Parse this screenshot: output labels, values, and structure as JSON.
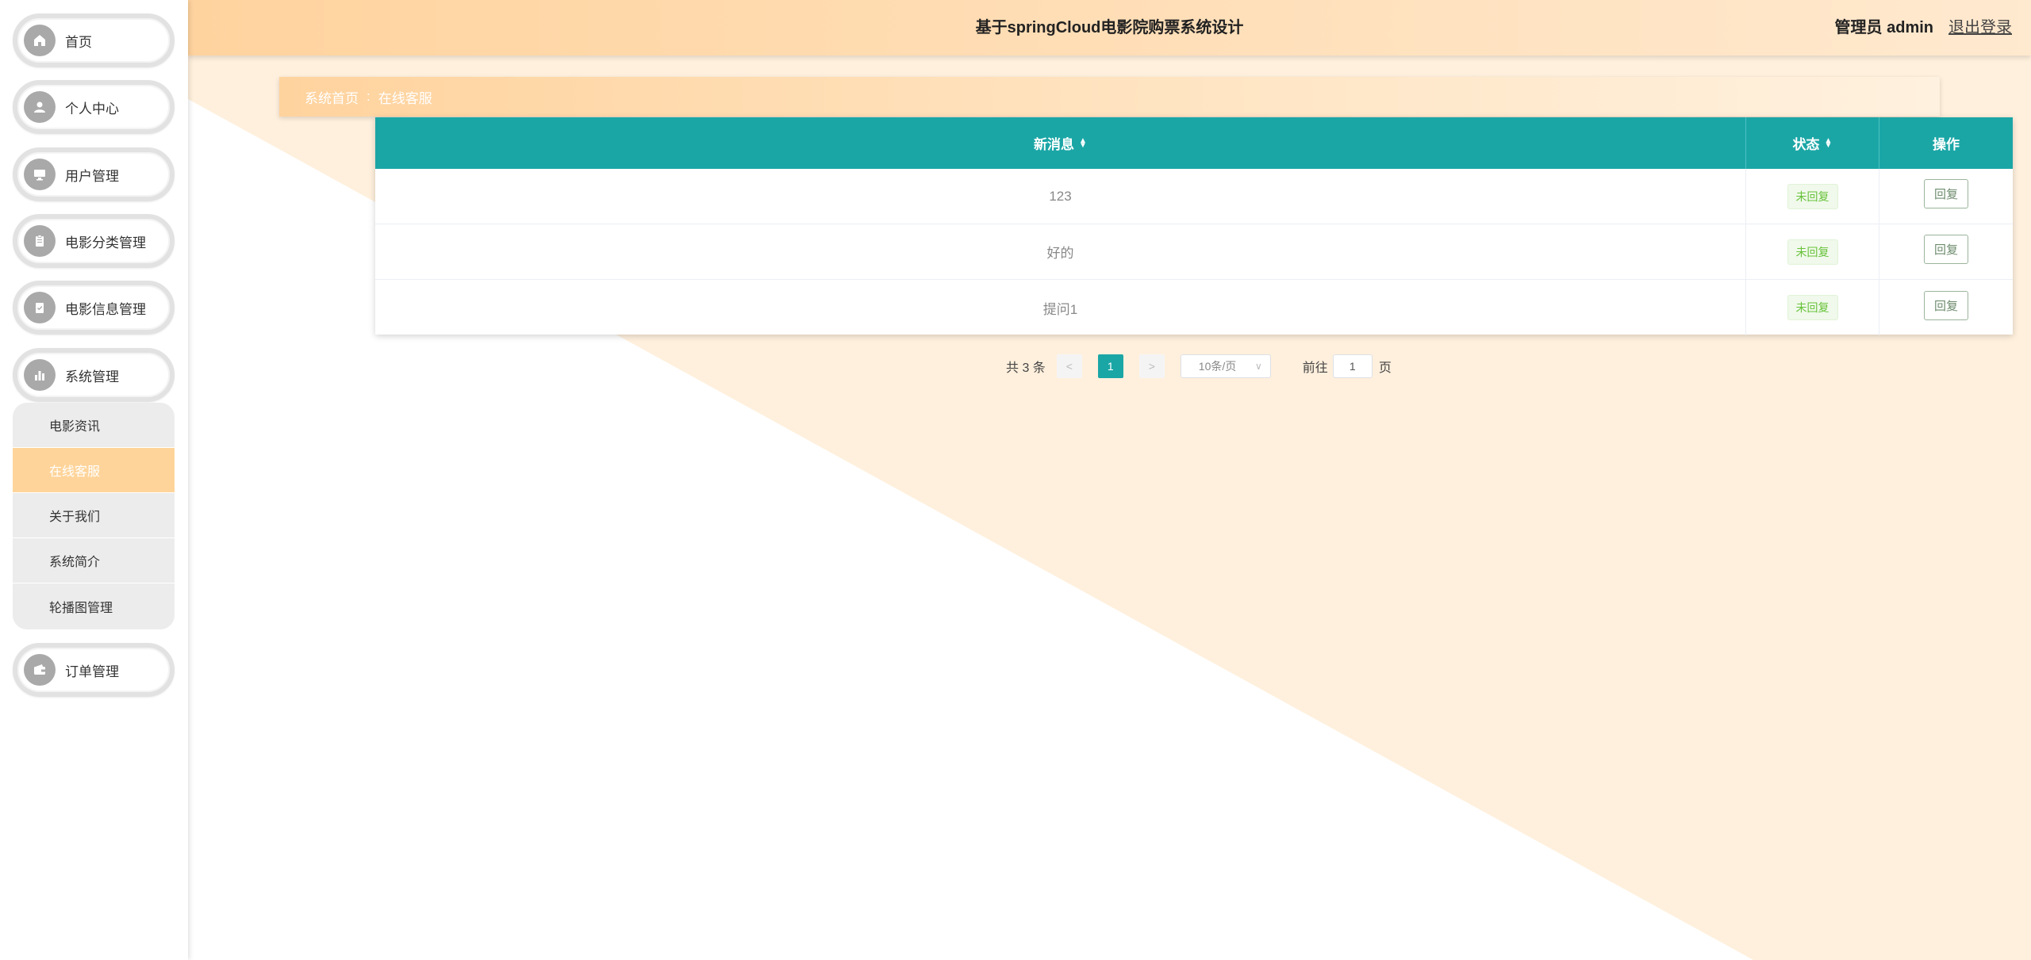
{
  "header": {
    "title": "基于springCloud电影院购票系统设计",
    "user_label": "管理员 admin",
    "logout_label": "退出登录"
  },
  "sidebar": {
    "items": [
      {
        "label": "首页",
        "icon": "home-icon"
      },
      {
        "label": "个人中心",
        "icon": "user-icon"
      },
      {
        "label": "用户管理",
        "icon": "monitor-icon"
      },
      {
        "label": "电影分类管理",
        "icon": "clipboard-icon"
      },
      {
        "label": "电影信息管理",
        "icon": "clipboard-check-icon"
      },
      {
        "label": "系统管理",
        "icon": "chart-icon"
      },
      {
        "label": "订单管理",
        "icon": "wallet-icon"
      }
    ],
    "submenu": [
      {
        "label": "电影资讯"
      },
      {
        "label": "在线客服"
      },
      {
        "label": "关于我们"
      },
      {
        "label": "系统简介"
      },
      {
        "label": "轮播图管理"
      }
    ]
  },
  "breadcrumb": {
    "home": "系统首页",
    "separator": ":",
    "current": "在线客服"
  },
  "table": {
    "headers": [
      "新消息",
      "状态",
      "操作"
    ],
    "rows": [
      {
        "message": "123",
        "status": "未回复",
        "action": "回复"
      },
      {
        "message": "好的",
        "status": "未回复",
        "action": "回复"
      },
      {
        "message": "提问1",
        "status": "未回复",
        "action": "回复"
      }
    ]
  },
  "pagination": {
    "total": "共 3 条",
    "prev": "<",
    "current_page": "1",
    "next": ">",
    "page_size": "10条/页",
    "goto_label": "前往",
    "goto_value": "1",
    "page_suffix": "页"
  },
  "colors": {
    "accent": "#1ba6a6",
    "header_gradient_start": "#ffd39e",
    "active_menu": "#ffd49a",
    "background_tint": "#fff0dd"
  }
}
